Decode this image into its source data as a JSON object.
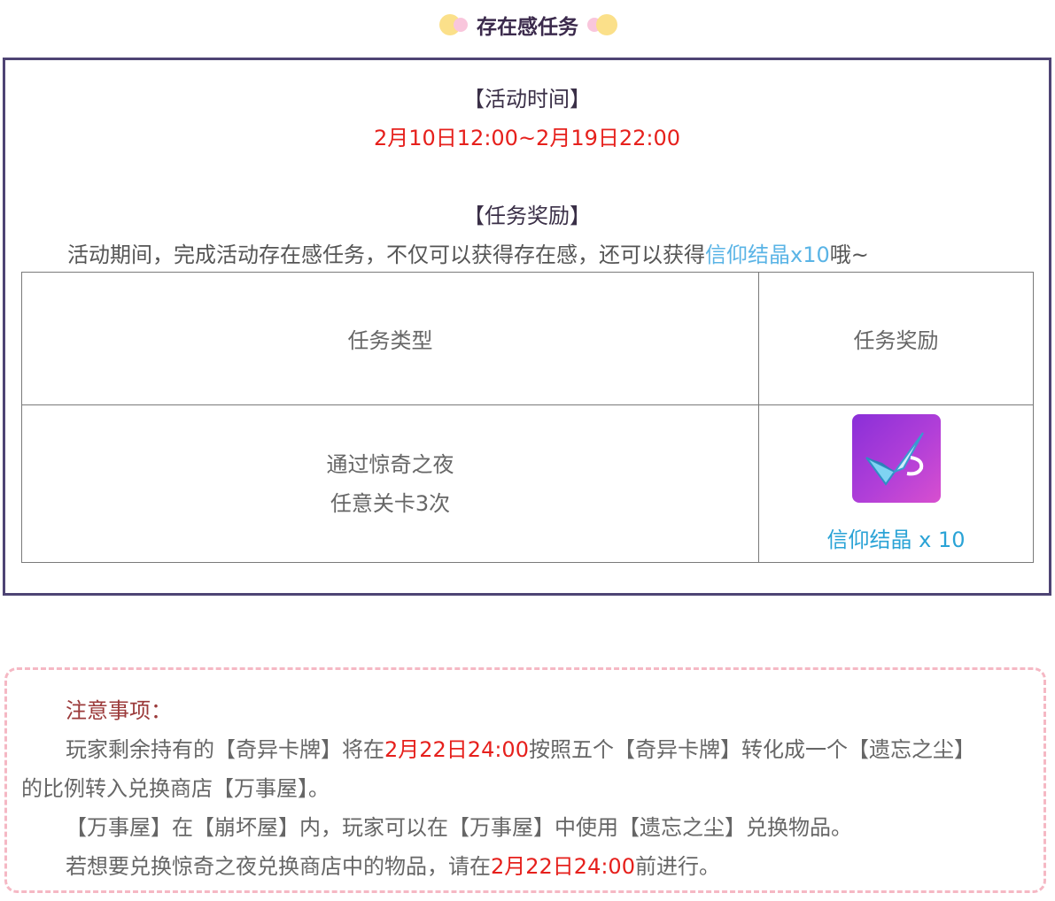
{
  "header": {
    "title": "存在感任务",
    "decor_left_icon": "yellow-pink-dots-icon",
    "decor_right_icon": "pink-yellow-dots-icon"
  },
  "event": {
    "time_heading": "【活动时间】",
    "time_range": "2月10日12:00~2月19日22:00",
    "reward_heading": "【任务奖励】",
    "intro_text": "活动期间，完成活动存在感任务，不仅可以获得存在感，还可以获得",
    "intro_highlight": "信仰结晶x10",
    "intro_suffix": "哦~"
  },
  "table": {
    "headers": [
      "任务类型",
      "任务奖励"
    ],
    "rows": [
      {
        "task_line1": "通过惊奇之夜",
        "task_line2": "任意关卡3次",
        "reward_icon": "faith-crystal-icon",
        "reward_label": "信仰结晶 x 10"
      }
    ]
  },
  "notice": {
    "title": "注意事项：",
    "p1_a": "玩家剩余持有的【奇异卡牌】将在",
    "p1_red": "2月22日24:00",
    "p1_b": "按照五个【奇异卡牌】转化成一个【遗忘之尘】",
    "p1_c": "的比例转入兑换商店【万事屋】。",
    "p2": "【万事屋】在【崩坏屋】内，玩家可以在【万事屋】中使用【遗忘之尘】兑换物品。",
    "p3_a": "若想要兑换惊奇之夜兑换商店中的物品，请在",
    "p3_red": "2月22日24:00",
    "p3_b": "前进行。"
  },
  "colors": {
    "border": "#4e4474",
    "accent_red": "#e6201c",
    "accent_blue": "#2aa3d6",
    "notice_border": "#f5b8c4"
  }
}
